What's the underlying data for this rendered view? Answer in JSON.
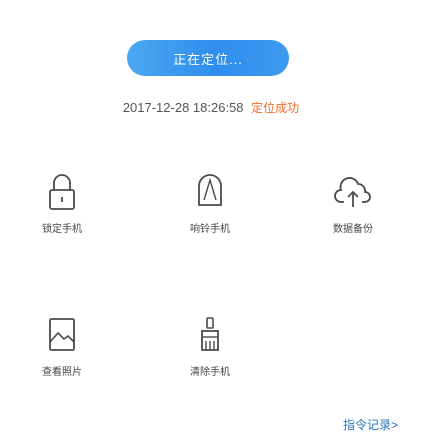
{
  "locate": {
    "label": "正在定位..."
  },
  "status": {
    "timestamp": "2017-12-28 18:26:58",
    "result": "定位成功"
  },
  "actions": [
    {
      "label": "锁定手机",
      "icon": "lock-icon"
    },
    {
      "label": "响铃手机",
      "icon": "bell-icon"
    },
    {
      "label": "数据备份",
      "icon": "cloud-upload-icon"
    },
    {
      "label": "查看照片",
      "icon": "image-icon"
    },
    {
      "label": "清除手机",
      "icon": "brush-icon"
    }
  ],
  "history": {
    "label": "指令记录>"
  },
  "colors": {
    "accent": "#2f8ded",
    "success": "#f06a2b",
    "link": "#2b73b9"
  }
}
